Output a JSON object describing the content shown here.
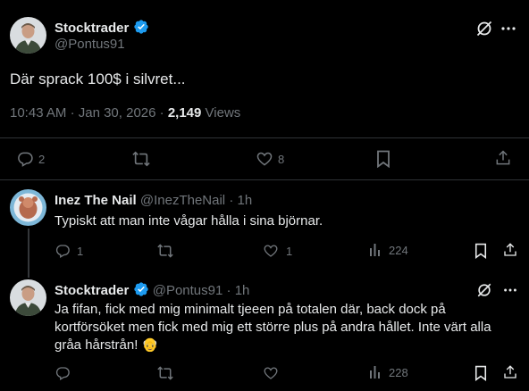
{
  "main_post": {
    "author_name": "Stocktrader",
    "handle": "@Pontus91",
    "text": "Där sprack 100$ i silvret...",
    "time": "10:43 AM",
    "date": "Jan 30, 2026",
    "separator": "·",
    "views_count": "2,149",
    "views_label": "Views",
    "replies": "2",
    "likes": "8"
  },
  "replies": [
    {
      "author_name": "Inez The Nail",
      "handle": "@InezTheNail",
      "separator": "·",
      "age": "1h",
      "text": "Typiskt att man inte vågar hålla i sina björnar.",
      "replies": "1",
      "likes": "1",
      "views": "224"
    },
    {
      "author_name": "Stocktrader",
      "handle": "@Pontus91",
      "separator": "·",
      "age": "1h",
      "text_line1": "Ja fifan, fick med mig minimalt tjeeen på totalen där, back dock på",
      "text_line2": "kortförsöket men fick med mig ett större plus på andra hållet. Inte värt alla",
      "text_line3": "gråa hårstrån!",
      "emoji": "👴",
      "views": "228"
    }
  ],
  "colors": {
    "background": "#000000",
    "text": "#e7e9ea",
    "muted": "#71767b",
    "verified": "#1d9bf0",
    "divider": "#2f3336"
  },
  "icons": [
    "verified-badge-icon",
    "grok-icon",
    "more-icon",
    "reply-icon",
    "repost-icon",
    "like-icon",
    "bookmark-icon",
    "share-icon",
    "views-icon"
  ]
}
